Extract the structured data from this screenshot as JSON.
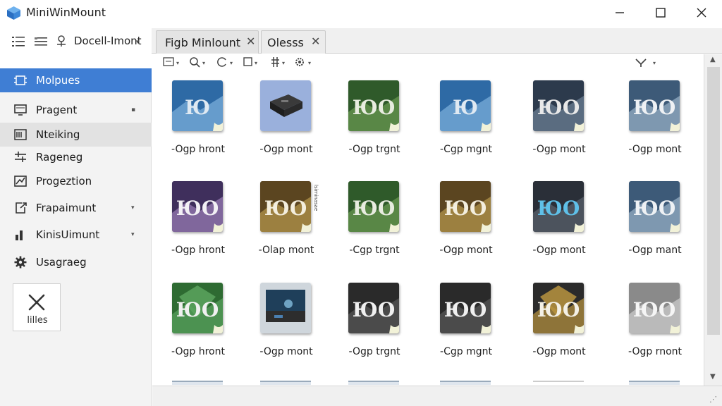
{
  "window": {
    "title": "MiniWinMount",
    "controls": {
      "minimize": "—",
      "maximize": "☐",
      "close": "✕"
    }
  },
  "toolbar": {
    "list_icon": "list-icon",
    "details_icon": "details-icon",
    "doc_icon": "document-mount-icon",
    "doc_label": "Docell-Imont",
    "caret": "▾"
  },
  "tabs": [
    {
      "label": "Figb Minlount",
      "close": "✕"
    },
    {
      "label": "Olesss",
      "close": "✕"
    }
  ],
  "sidebar": {
    "items": [
      {
        "label": "Molpues",
        "icon": "chip-icon",
        "active": true
      },
      {
        "label": "Pragent",
        "icon": "monitor-icon",
        "caret": "▪"
      },
      {
        "label": "Nteiking",
        "icon": "network-icon",
        "hover": true
      },
      {
        "label": "Rageneg",
        "icon": "sliders-icon"
      },
      {
        "label": "Progeztion",
        "icon": "chart-icon"
      },
      {
        "label": "Frapaimunt",
        "icon": "export-icon",
        "caret": "▾"
      },
      {
        "label": "KinisUimunt",
        "icon": "bar-icon",
        "caret": "▾"
      },
      {
        "label": "Usagraeg",
        "icon": "gear-icon"
      }
    ],
    "close_tile": {
      "label": "lilles",
      "icon": "close-icon"
    }
  },
  "content_toolbar": {
    "view_icon": "view-icon",
    "search_icon": "search-icon",
    "refresh_icon": "refresh-icon",
    "select_icon": "checkbox-icon",
    "filter_icon": "filter-icon",
    "settings_icon": "gear-icon",
    "branch_icon": "branch-icon",
    "caret": "▾"
  },
  "grid": {
    "rows": [
      [
        {
          "caption": "-Ogp hront",
          "style": "blue-arrows",
          "glyph": "Ю"
        },
        {
          "caption": "-Ogp mont",
          "style": "drive",
          "glyph": ""
        },
        {
          "caption": "-Ogp trgnt",
          "style": "green",
          "glyph": "ЮO"
        },
        {
          "caption": "-Cgp mgnt",
          "style": "blue-arrows",
          "glyph": "Ю"
        },
        {
          "caption": "-Ogp mont",
          "style": "slate",
          "glyph": "ЮO"
        },
        {
          "caption": "-Ogp mont",
          "style": "slate-light",
          "glyph": "ЮO"
        }
      ],
      [
        {
          "caption": "-Ogp hront",
          "style": "purple",
          "glyph": "ЮO"
        },
        {
          "caption": "-Olap mont",
          "style": "gold",
          "glyph": "ЮO"
        },
        {
          "caption": "-Cgp trgnt",
          "style": "green",
          "glyph": "ЮO"
        },
        {
          "caption": "-Ogp mont",
          "style": "gold",
          "glyph": "ЮO"
        },
        {
          "caption": "-Ogp mont",
          "style": "cyan",
          "glyph": "ЮO"
        },
        {
          "caption": "-Ogp mant",
          "style": "slate-light",
          "glyph": "ЮO"
        }
      ],
      [
        {
          "caption": "-Ogp hront",
          "style": "green-diamond",
          "glyph": "ЮO"
        },
        {
          "caption": "-Ogp mont",
          "style": "photo",
          "glyph": ""
        },
        {
          "caption": "-Ogp trgnt",
          "style": "dark",
          "glyph": "ЮO"
        },
        {
          "caption": "-Cgp mgnt",
          "style": "dark",
          "glyph": "ЮO"
        },
        {
          "caption": "-Ogp mont",
          "style": "gold-diamond",
          "glyph": "ЮO"
        },
        {
          "caption": "-Ogp rnont",
          "style": "gray",
          "glyph": "ЮO"
        }
      ]
    ]
  },
  "side_label_vertical": "lsiminasae",
  "colors": {
    "accent": "#3f7ed4",
    "sidebar_bg": "#f3f3f3",
    "hover": "#e2e2e2"
  }
}
